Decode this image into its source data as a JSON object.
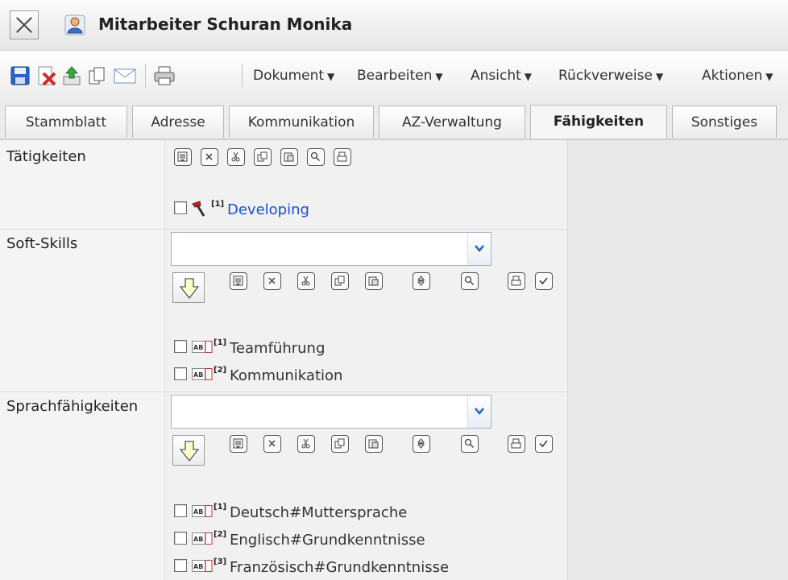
{
  "window": {
    "title": "Mitarbeiter Schuran Monika"
  },
  "toolbar": {
    "icons": [
      "save-icon",
      "delete-icon",
      "upload-icon",
      "copy-icon",
      "mail-icon",
      "print-icon"
    ],
    "menus": [
      "Dokument",
      "Bearbeiten",
      "Ansicht",
      "Rückverweise",
      "Aktionen"
    ]
  },
  "tabs": [
    "Stammblatt",
    "Adresse",
    "Kommunikation",
    "AZ-Verwaltung",
    "Fähigkeiten",
    "Sonstiges"
  ],
  "active_tab": "Fähigkeiten",
  "sections": {
    "taetigkeiten": {
      "label": "Tätigkeiten",
      "items": [
        {
          "index": "[1]",
          "text": "Developing"
        }
      ]
    },
    "softskills": {
      "label": "Soft-Skills",
      "select_value": "",
      "items": [
        {
          "index": "[1]",
          "text": "Teamführung"
        },
        {
          "index": "[2]",
          "text": "Kommunikation"
        }
      ]
    },
    "sprachen": {
      "label": "Sprachfähigkeiten",
      "select_value": "",
      "items": [
        {
          "index": "[1]",
          "text": "Deutsch#Muttersprache"
        },
        {
          "index": "[2]",
          "text": "Englisch#Grundkenntnisse"
        },
        {
          "index": "[3]",
          "text": "Französisch#Grundkenntnisse"
        }
      ]
    }
  },
  "colors": {
    "link": "#1a4fd0",
    "accent_blue": "#2a63c6"
  }
}
